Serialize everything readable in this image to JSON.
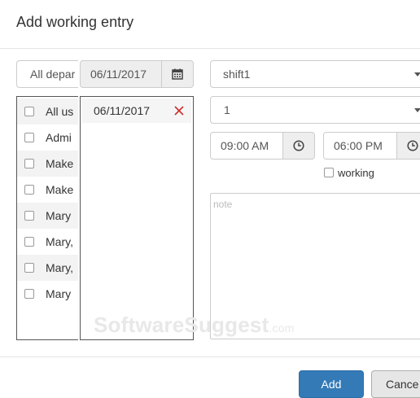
{
  "dialog": {
    "title": "Add working entry"
  },
  "filters": {
    "department": "All depar",
    "date": "06/11/2017"
  },
  "users": [
    {
      "label": "All us"
    },
    {
      "label": "Admi"
    },
    {
      "label": "Make"
    },
    {
      "label": "Make"
    },
    {
      "label": "Mary"
    },
    {
      "label": "Mary,"
    },
    {
      "label": "Mary,"
    },
    {
      "label": "Mary"
    }
  ],
  "selected_dates": [
    {
      "date": "06/11/2017"
    }
  ],
  "form": {
    "shift": "shift1",
    "count": "1",
    "start_time": "09:00 AM",
    "end_time": "06:00 PM",
    "working_label": "working",
    "note_placeholder": "note"
  },
  "buttons": {
    "add": "Add",
    "cancel": "Cance"
  },
  "watermark": {
    "brand": "SoftwareSuggest",
    "suffix": ".com"
  },
  "colors": {
    "primary": "#337ab7",
    "remove": "#c9302c"
  }
}
